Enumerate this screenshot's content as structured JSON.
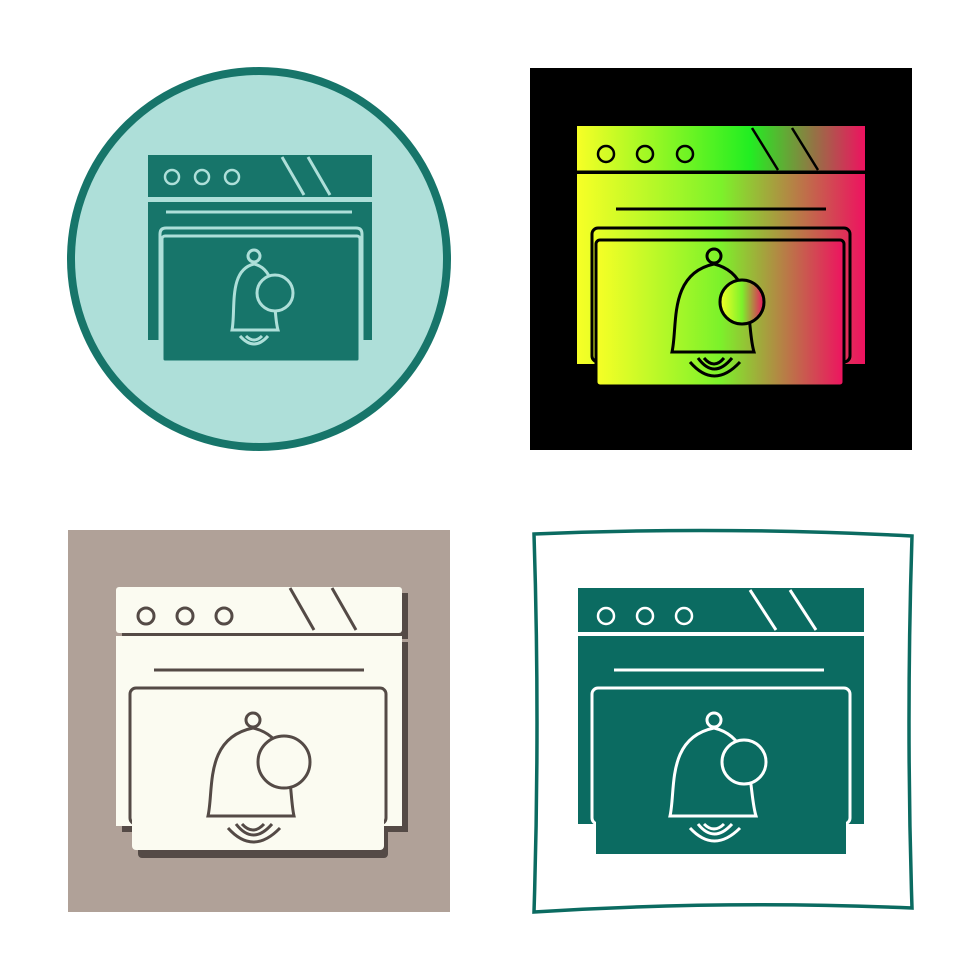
{
  "colors": {
    "background": "#ffffff",
    "teal": "#17756a",
    "mint": "#aedfd9",
    "black": "#000000",
    "gradient_start": "#f7ff26",
    "gradient_mid": "#22ee22",
    "gradient_end": "#ee1260",
    "taupe": "#b0a198",
    "cream": "#fbfbf1",
    "shadow": "#544a46",
    "dark_teal": "#0b6b61"
  },
  "tiles": [
    {
      "style": "circle-glyph",
      "icon": "browser-notification-bell-icon"
    },
    {
      "style": "gradient-glyph",
      "icon": "browser-notification-bell-icon"
    },
    {
      "style": "cream-shadow-glyph",
      "icon": "browser-notification-bell-icon"
    },
    {
      "style": "framed-glyph",
      "icon": "browser-notification-bell-icon"
    }
  ]
}
